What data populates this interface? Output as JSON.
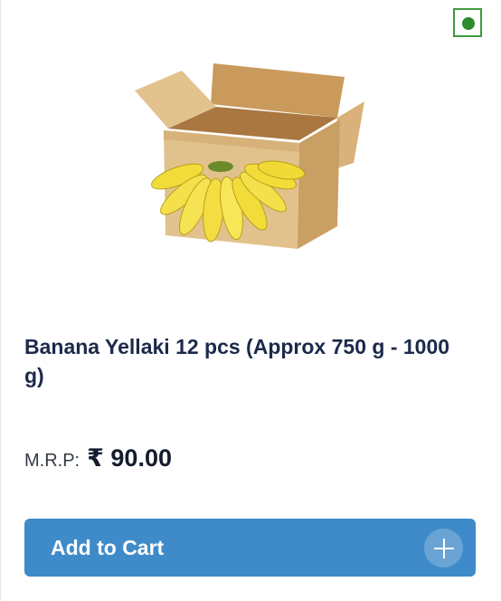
{
  "product": {
    "title": "Banana Yellaki 12 pcs (Approx 750 g - 1000 g)",
    "mrp_label": "M.R.P:",
    "price": "₹ 90.00",
    "image_icon": "banana-box-image",
    "veg_indicator": "veg-dot-icon"
  },
  "actions": {
    "add_to_cart_label": "Add to Cart",
    "add_icon": "plus-icon"
  },
  "colors": {
    "button": "#3f8bca",
    "veg_green": "#2e8b2e",
    "title": "#1c2a4a"
  }
}
